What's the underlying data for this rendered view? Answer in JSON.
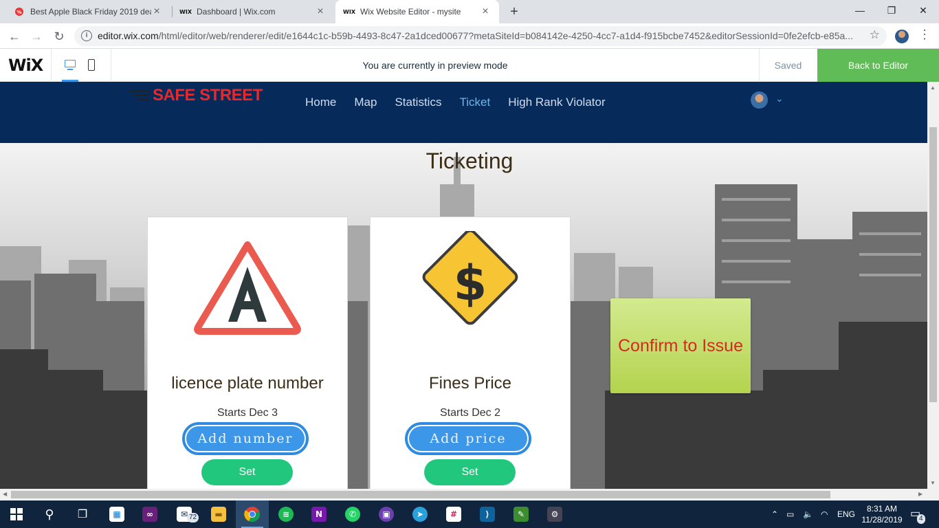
{
  "browser": {
    "tabs": [
      {
        "title": "Best Apple Black Friday 2019 dea",
        "favicon": "deal-favicon"
      },
      {
        "title": "Dashboard | Wix.com",
        "favicon": "wix-favicon"
      },
      {
        "title": "Wix Website Editor - mysite",
        "favicon": "wix-favicon"
      }
    ],
    "url_domain": "editor.wix.com",
    "url_rest": "/html/editor/web/renderer/edit/e1644c1c-b59b-4493-8c47-2a1dced00677?metaSiteId=b084142e-4250-4cc7-a1d4-f915bcbe7452&editorSessionId=0fe2efcb-e85a..."
  },
  "wixbar": {
    "logo": "WiX",
    "message": "You are currently in preview mode",
    "saved": "Saved",
    "back_to_editor": "Back to Editor"
  },
  "site": {
    "brand": "SAFE STREET",
    "nav": [
      "Home",
      "Map",
      "Statistics",
      "Ticket",
      "High Rank Violator"
    ],
    "active_nav": "Ticket",
    "title": "Ticketing",
    "cards": [
      {
        "title": "licence plate number",
        "date": "Starts Dec 3",
        "button": "Add number",
        "set": "Set",
        "icon": "letter-a-warning-icon"
      },
      {
        "title": "Fines Price",
        "date": "Starts Dec 2",
        "button": "Add price",
        "set": "Set",
        "icon": "dollar-sign-icon"
      }
    ],
    "confirm": "Confirm to Issue"
  },
  "taskbar": {
    "mail_badge": "72",
    "language": "ENG",
    "time": "8:31 AM",
    "date": "11/28/2019",
    "notifications": "4"
  },
  "colors": {
    "header_bg": "#062a5a",
    "accent_blue": "#3d97e8",
    "set_green": "#22c77e",
    "confirm_green": "#b4d34e",
    "brand_red": "#e8282b",
    "editor_green": "#60bc57"
  }
}
